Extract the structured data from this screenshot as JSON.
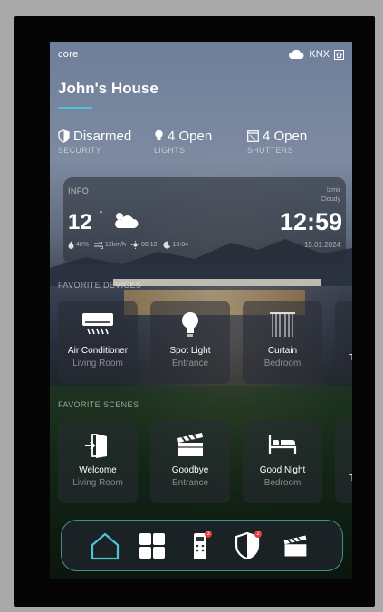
{
  "header": {
    "logo": "core",
    "connection": "KNX"
  },
  "home": {
    "title": "John's House"
  },
  "status": [
    {
      "value": "Disarmed",
      "label": "SECURITY"
    },
    {
      "value": "4 Open",
      "label": "LIGHTS"
    },
    {
      "value": "4 Open",
      "label": "SHUTTERS"
    }
  ],
  "info": {
    "label": "INFO",
    "location": "Izmir",
    "condition": "Cloudy",
    "temperature": "12",
    "degree": "°",
    "time": "12:59",
    "date": "15.01.2024",
    "humidity": "40%",
    "wind": "12km/h",
    "sunrise": "08:12",
    "sunset": "18:04"
  },
  "favorite_devices": {
    "title": "FAVORITE DEVICES",
    "items": [
      {
        "name": "Air Conditioner",
        "room": "Living Room",
        "icon": "air-conditioner-icon"
      },
      {
        "name": "Spot Light",
        "room": "Entrance",
        "icon": "light-bulb-icon"
      },
      {
        "name": "Curtain",
        "room": "Bedroom",
        "icon": "curtain-icon"
      }
    ],
    "peek": "T"
  },
  "favorite_scenes": {
    "title": "FAVORITE SCENES",
    "items": [
      {
        "name": "Welcome",
        "room": "Living Room",
        "icon": "door-enter-icon"
      },
      {
        "name": "Goodbye",
        "room": "Entrance",
        "icon": "clapperboard-icon"
      },
      {
        "name": "Good Night",
        "room": "Bedroom",
        "icon": "bed-icon"
      }
    ],
    "peek": "T"
  },
  "nav": {
    "remote_badge": "3",
    "security_badge": "2"
  },
  "colors": {
    "accent": "#4fc3d6",
    "nav_border": "#3f8f8c",
    "badge": "#e23b3b"
  }
}
